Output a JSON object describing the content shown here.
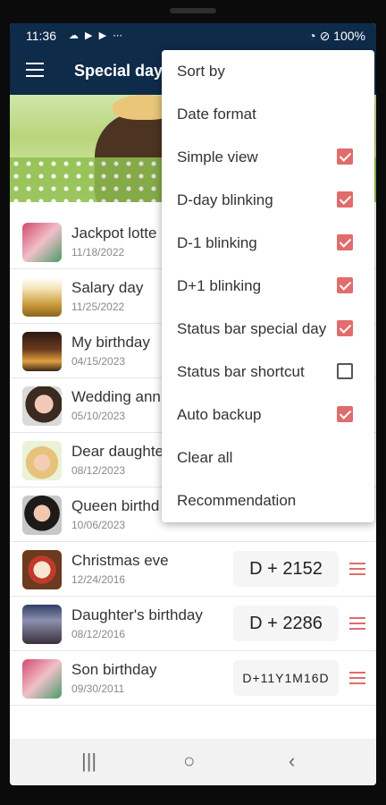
{
  "status_bar": {
    "time": "11:36",
    "notif_icons": "☁ ▶ ▶ ⋯",
    "right_icons": "◔ ⊘ 100%"
  },
  "app": {
    "title": "Special days"
  },
  "items": [
    {
      "title": "Jackpot lotte",
      "date": "11/18/2022"
    },
    {
      "title": "Salary day",
      "date": "11/25/2022"
    },
    {
      "title": "My birthday",
      "date": "04/15/2023"
    },
    {
      "title": "Wedding ann",
      "date": "05/10/2023"
    },
    {
      "title": "Dear daughte",
      "date": "08/12/2023"
    },
    {
      "title": "Queen birthd",
      "date": "10/06/2023"
    },
    {
      "title": "Christmas eve",
      "date": "12/24/2016",
      "dday": "D + 2152"
    },
    {
      "title": "Daughter's birthday",
      "date": "08/12/2016",
      "dday": "D + 2286"
    },
    {
      "title": "Son birthday",
      "date": "09/30/2011",
      "dday": "D+11Y1M16D"
    }
  ],
  "menu": {
    "items": [
      {
        "label": "Sort by"
      },
      {
        "label": "Date format"
      },
      {
        "label": "Simple view",
        "checked": true
      },
      {
        "label": "D-day blinking",
        "checked": true
      },
      {
        "label": "D-1 blinking",
        "checked": true
      },
      {
        "label": "D+1 blinking",
        "checked": true
      },
      {
        "label": "Status bar special day",
        "checked": true
      },
      {
        "label": "Status bar shortcut",
        "checked": false
      },
      {
        "label": "Auto backup",
        "checked": true
      },
      {
        "label": "Clear all"
      },
      {
        "label": "Recommendation"
      }
    ]
  },
  "nav": {
    "recents": "|||",
    "home": "○",
    "back": "‹"
  },
  "colors": {
    "appbar": "#0f2b4a",
    "accent": "#e06c6c"
  }
}
